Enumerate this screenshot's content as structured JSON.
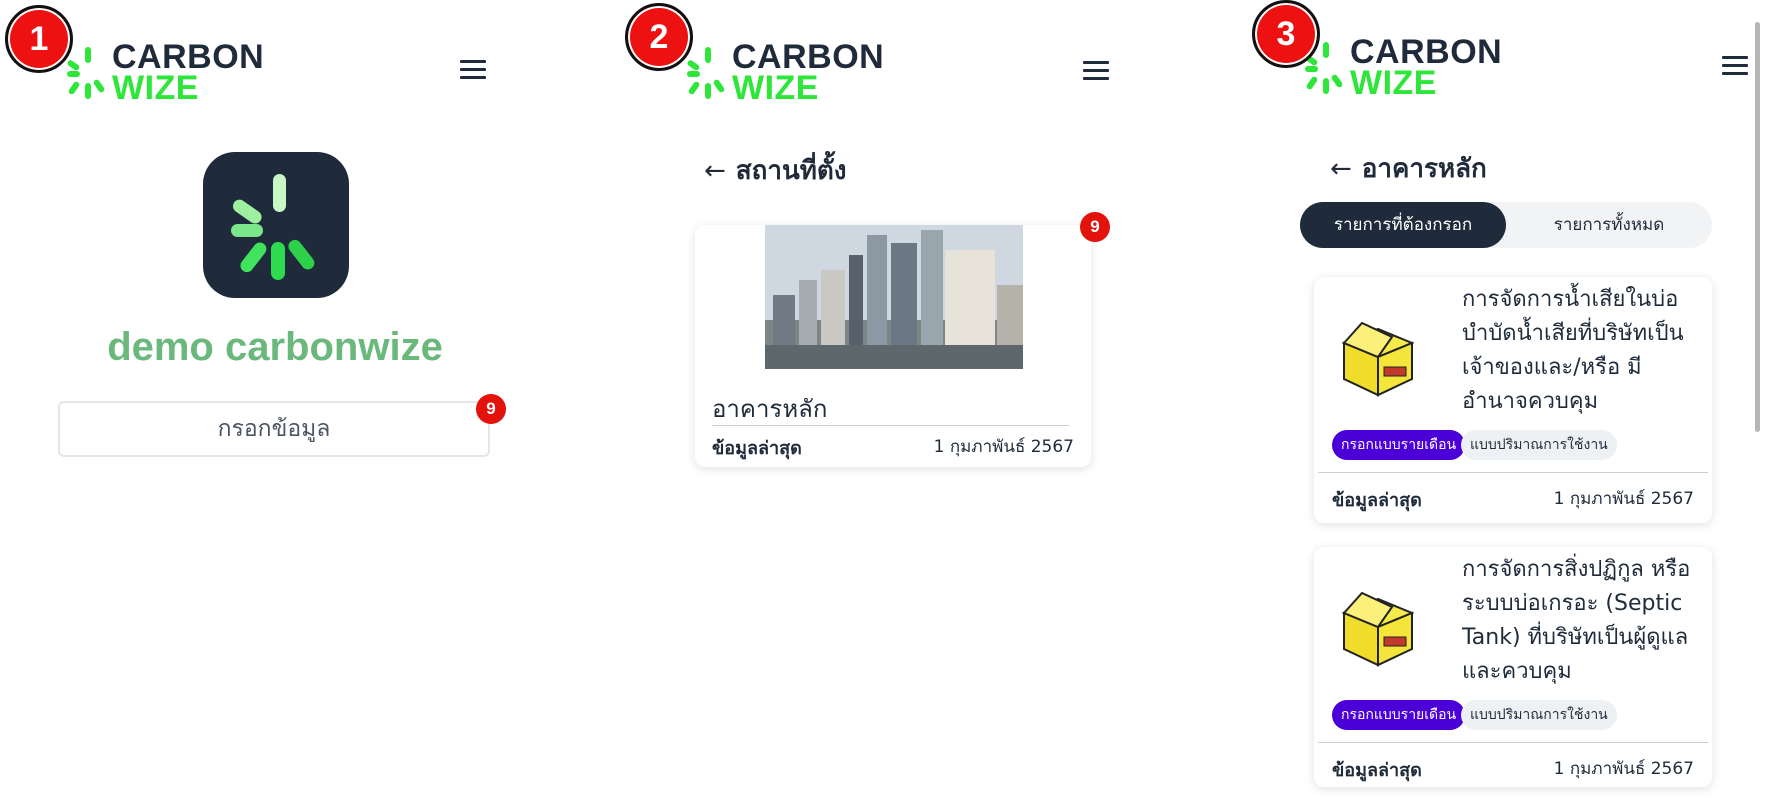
{
  "steps": [
    "1",
    "2",
    "3"
  ],
  "logo": {
    "line1": "CARBON",
    "line2": "WIZE"
  },
  "screen1": {
    "app_name": "demo carbonwize",
    "fill_button": "กรอกข้อมูล",
    "badge": "9"
  },
  "screen2": {
    "back_arrow": "←",
    "title": "สถานที่ตั้ง",
    "badge": "9",
    "location": {
      "name": "อาคารหลัก",
      "latest_label": "ข้อมูลล่าสุด",
      "latest_value": "1 กุมภาพันธ์ 2567"
    }
  },
  "screen3": {
    "back_arrow": "←",
    "title": "อาคารหลัก",
    "tabs": [
      "รายการที่ต้องกรอก",
      "รายการทั้งหมด"
    ],
    "items": [
      {
        "title": "การจัดการน้ำเสียในบ่อบำบัดน้ำเสียที่บริษัทเป็นเจ้าของและ/หรือ มีอำนาจควบคุม",
        "tag1": "กรอกแบบรายเดือน",
        "tag2": "แบบปริมาณการใช้งาน",
        "latest_label": "ข้อมูลล่าสุด",
        "latest_value": "1 กุมภาพันธ์ 2567"
      },
      {
        "title": "การจัดการสิ่งปฏิกูล หรือ ระบบบ่อเกรอะ (Septic Tank) ที่บริษัทเป็นผู้ดูแลและควบคุม",
        "tag1": "กรอกแบบรายเดือน",
        "tag2": "แบบปริมาณการใช้งาน",
        "latest_label": "ข้อมูลล่าสุด",
        "latest_value": "1 กุมภาพันธ์ 2567"
      }
    ]
  },
  "colors": {
    "brand_green": "#2ee63a",
    "navy": "#1f2b3a",
    "badge_red": "#e3120b",
    "tag_purple": "#4b00d8"
  }
}
